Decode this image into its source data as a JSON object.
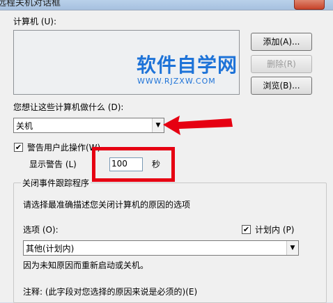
{
  "window": {
    "title": "远程关机对话框"
  },
  "computers": {
    "label": "计算机 (U):"
  },
  "buttons": {
    "add": "添加(A)...",
    "remove": "删除(R)",
    "browse": "浏览(B)..."
  },
  "watermark": {
    "cn": "软件自学网",
    "url": "WWW.RJZXW.COM"
  },
  "action": {
    "label": "您想让这些计算机做什么 (D):",
    "selected": "关机"
  },
  "warn": {
    "label": "警告用户此操作(W)",
    "checked": true,
    "display_label": "显示警告 (L)",
    "value": "100",
    "unit": "秒"
  },
  "tracker": {
    "title": "关闭事件跟踪程序",
    "description": "请选择最准确描述您关闭计算机的原因的选项",
    "option_label": "选项 (O):",
    "planned_label": "计划内 (P)",
    "planned_checked": true,
    "option_selected": "其他(计划内)",
    "option_description": "因为未知原因而重新启动或关机。",
    "comment_label": "注释: (此字段对您选择的原因来说是必须的)(E)"
  },
  "colors": {
    "annotation_red": "#e60012",
    "watermark_blue": "#1e73d8"
  }
}
